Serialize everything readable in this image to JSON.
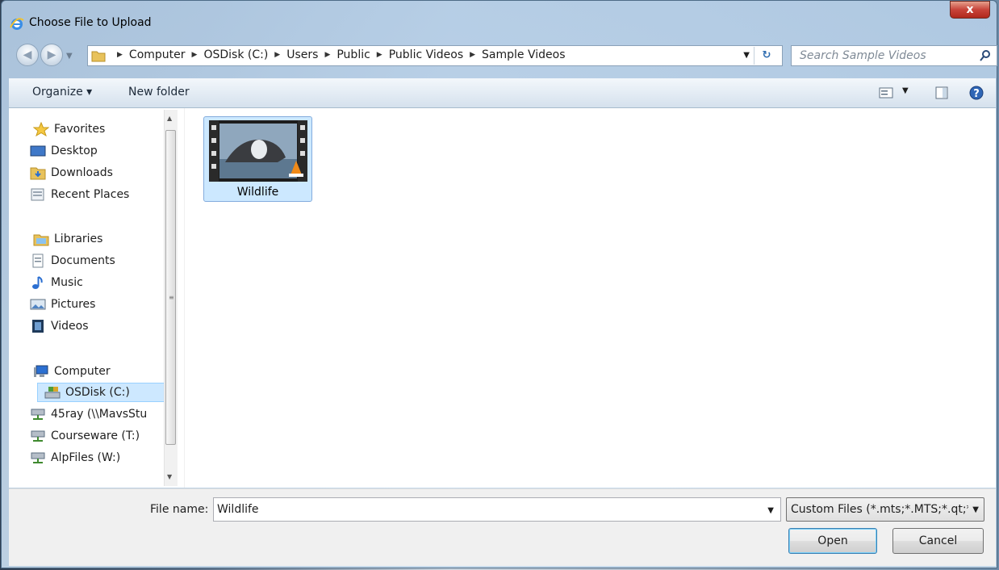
{
  "window": {
    "title": "Choose File to Upload",
    "close_label": "x"
  },
  "address": {
    "breadcrumbs": [
      "Computer",
      "OSDisk (C:)",
      "Users",
      "Public",
      "Public Videos",
      "Sample Videos"
    ]
  },
  "search": {
    "placeholder": "Search Sample Videos"
  },
  "toolbar": {
    "organize_label": "Organize ▾",
    "new_folder_label": "New folder"
  },
  "nav": {
    "favorites": {
      "label": "Favorites",
      "items": [
        "Desktop",
        "Downloads",
        "Recent Places"
      ]
    },
    "libraries": {
      "label": "Libraries",
      "items": [
        "Documents",
        "Music",
        "Pictures",
        "Videos"
      ]
    },
    "computer": {
      "label": "Computer",
      "items": [
        "OSDisk (C:)",
        "45ray (\\\\MavsStu",
        "Courseware (T:)",
        "AlpFiles (W:)"
      ]
    }
  },
  "files": [
    {
      "name": "Wildlife",
      "type": "video"
    }
  ],
  "bottom": {
    "file_name_label": "File name:",
    "file_name_value": "Wildlife",
    "filter_value": "Custom Files (*.mts;*.MTS;*.qt;*",
    "open_label": "Open",
    "cancel_label": "Cancel"
  },
  "colors": {
    "selection": "#cce8ff",
    "selection_border": "#84acdd",
    "close_red": "#c7443a"
  }
}
